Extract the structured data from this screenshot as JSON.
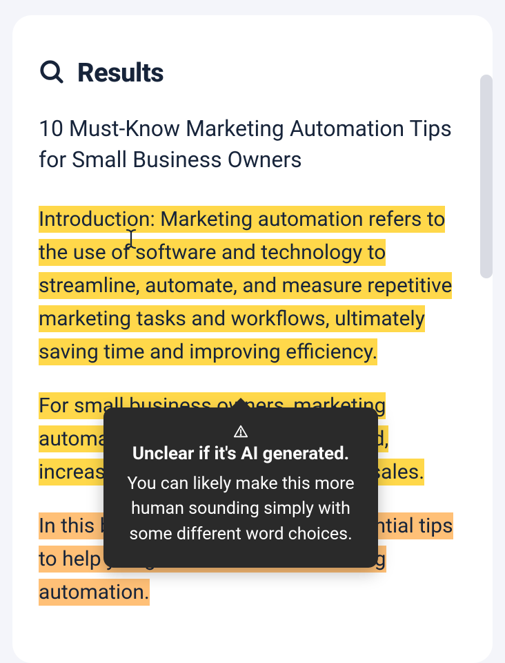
{
  "header": {
    "heading": "Results"
  },
  "article": {
    "title": "10 Must-Know Marketing Automation Tips for Small Business Owners",
    "paragraphs": [
      {
        "highlight": "yellow",
        "text": "Introduction: Marketing automation refers to the use of software and technology to streamline, automate, and measure repetitive marketing tasks and workflows, ultimately saving time and improving efficiency."
      },
      {
        "highlight": "yellow",
        "text": "For small business owners, marketing automation can help reduce workload, increase lead generation, and boost sales."
      },
      {
        "highlight": "orange",
        "text": "In this blog post, we'll share ten essential tips to help you get started with marketing automation."
      }
    ]
  },
  "tooltip": {
    "title": "Unclear if it's AI generated.",
    "body": "You can likely make this more human sounding simply with some different word choices."
  }
}
